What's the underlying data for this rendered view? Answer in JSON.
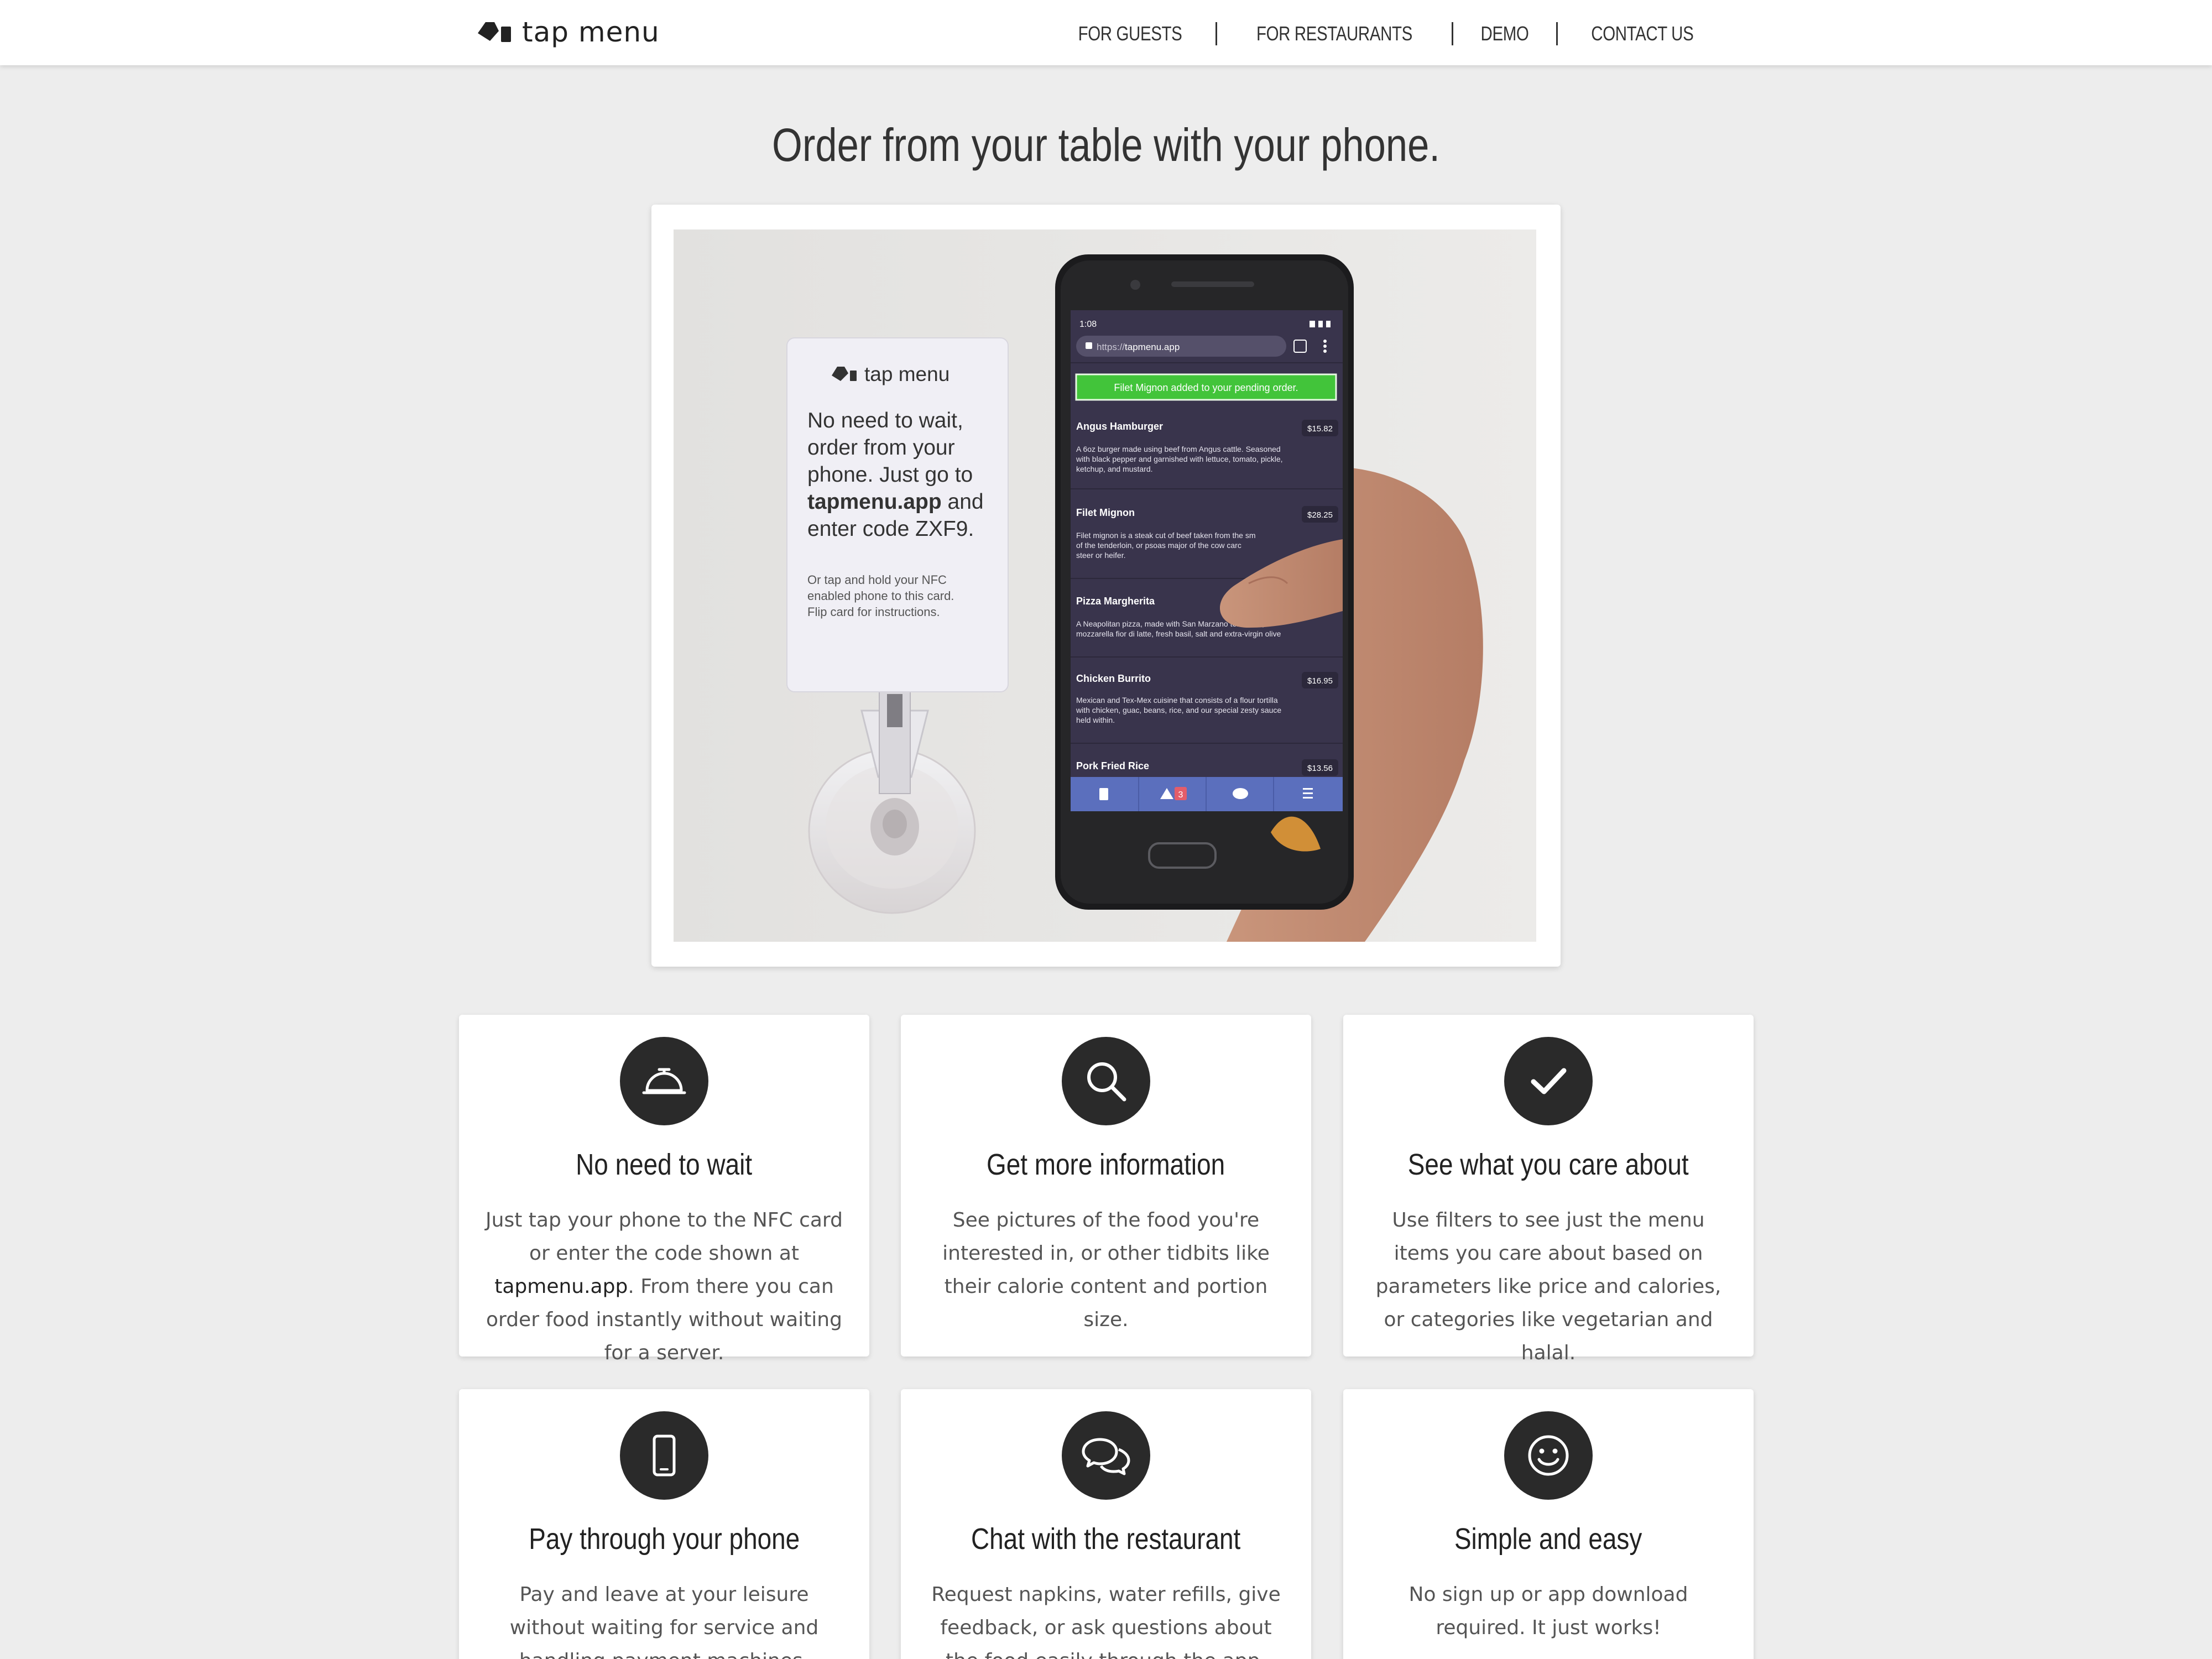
{
  "brand": {
    "name": "tap menu"
  },
  "nav": {
    "items": [
      "FOR GUESTS",
      "FOR RESTAURANTS",
      "DEMO",
      "CONTACT US"
    ]
  },
  "hero": {
    "title": "Order from your table with your phone."
  },
  "media": {
    "card": {
      "brand": "tap menu",
      "line1": "No need to wait,",
      "line2": "order from your",
      "line3": "phone. Just go to",
      "line4_link": "tapmenu.app",
      "line4_rest": " and",
      "line5": "enter code ZXF9.",
      "small1": "Or tap and hold your NFC",
      "small2": "enabled phone to this card.",
      "small3": "Flip card for instructions."
    },
    "phone": {
      "time": "1:08",
      "url_prefix": "https://",
      "url_host": "tapmenu.app",
      "toast": "Filet Mignon added to your pending order.",
      "badge": "3",
      "items": [
        {
          "name": "Angus Hamburger",
          "price": "$15.82",
          "d1": "A 6oz burger made using beef from Angus cattle. Seasoned",
          "d2": "with black pepper and garnished with lettuce, tomato, pickle,",
          "d3": "ketchup, and mustard."
        },
        {
          "name": "Filet Mignon",
          "price": "$28.25",
          "d1": "Filet mignon is a steak cut of beef taken from the sm",
          "d2": "of the tenderloin, or psoas major of the cow carc",
          "d3": "steer or heifer."
        },
        {
          "name": "Pizza Margherita",
          "price": "",
          "d1": "A Neapolitan pizza, made with San Marzano tomatoes,",
          "d2": "mozzarella fior di latte, fresh basil, salt and extra-virgin olive",
          "d3": ""
        },
        {
          "name": "Chicken Burrito",
          "price": "$16.95",
          "d1": "Mexican and Tex-Mex cuisine that consists of a flour tortilla",
          "d2": "with chicken, guac, beans, rice, and our special zesty sauce",
          "d3": "held within."
        },
        {
          "name": "Pork Fried Rice",
          "price": "$13.56",
          "d1": "",
          "d2": "",
          "d3": ""
        }
      ]
    }
  },
  "features": [
    {
      "icon": "service-bell-icon",
      "title": "No need to wait",
      "text_before": "Just tap your phone to the NFC card or enter the code shown at ",
      "text_link": "tapmenu.app",
      "text_after": ". From there you can order food instantly without waiting for a server."
    },
    {
      "icon": "search-icon",
      "title": "Get more information",
      "text": "See pictures of the food you're interested in, or other tidbits like their calorie content and portion size."
    },
    {
      "icon": "checkmark-icon",
      "title": "See what you care about",
      "text": "Use filters to see just the menu items you care about based on parameters like price and calories, or categories like vegetarian and halal."
    },
    {
      "icon": "mobile-phone-icon",
      "title": "Pay through your phone",
      "text": "Pay and leave at your leisure without waiting for service and handling payment machines."
    },
    {
      "icon": "chat-bubbles-icon",
      "title": "Chat with the restaurant",
      "text": "Request napkins, water refills, give feedback, or ask questions about the food easily through the app."
    },
    {
      "icon": "smiley-face-icon",
      "title": "Simple and easy",
      "text": "No sign up or app download required. It just works!"
    }
  ],
  "colors": {
    "page_bg": "#ededed",
    "icon_circle": "#2a2a2a",
    "toast_green": "#3ec63a",
    "phone_screen": "#3b3550"
  }
}
